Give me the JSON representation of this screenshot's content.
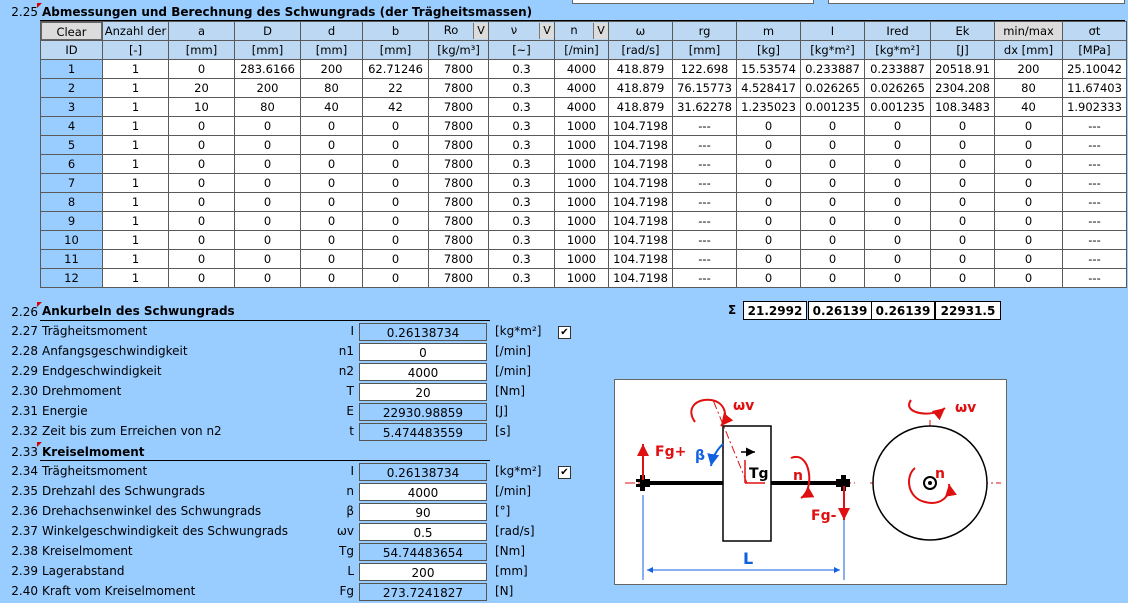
{
  "sections": {
    "s225": {
      "num": "2.25",
      "title": "Abmessungen und Berechnung des Schwungrads (der Trägheitsmassen)"
    },
    "s226": {
      "num": "2.26",
      "title": "Ankurbeln des Schwungrads"
    },
    "s233": {
      "num": "2.33",
      "title": "Kreiselmoment"
    }
  },
  "table": {
    "clear_label": "Clear",
    "v_label": "V",
    "headers": [
      "Anzahl der",
      "a",
      "D",
      "d",
      "b",
      "Ro",
      "ν",
      "n",
      "ω",
      "rg",
      "m",
      "I",
      "Ired",
      "Ek",
      "min/max",
      "σt"
    ],
    "units": [
      "ID",
      "[-]",
      "[mm]",
      "[mm]",
      "[mm]",
      "[mm]",
      "[kg/m³]",
      "[~]",
      "[/min]",
      "[rad/s]",
      "[mm]",
      "[kg]",
      "[kg*m²]",
      "[kg*m²]",
      "[J]",
      "dx [mm]",
      "[MPa]"
    ],
    "rows": [
      [
        "1",
        "1",
        "0",
        "283.6166",
        "200",
        "62.71246",
        "7800",
        "0.3",
        "4000",
        "418.879",
        "122.698",
        "15.53574",
        "0.233887",
        "0.233887",
        "20518.91",
        "200",
        "25.10042"
      ],
      [
        "2",
        "1",
        "20",
        "200",
        "80",
        "22",
        "7800",
        "0.3",
        "4000",
        "418.879",
        "76.15773",
        "4.528417",
        "0.026265",
        "0.026265",
        "2304.208",
        "80",
        "11.67403"
      ],
      [
        "3",
        "1",
        "10",
        "80",
        "40",
        "42",
        "7800",
        "0.3",
        "4000",
        "418.879",
        "31.62278",
        "1.235023",
        "0.001235",
        "0.001235",
        "108.3483",
        "40",
        "1.902333"
      ],
      [
        "4",
        "1",
        "0",
        "0",
        "0",
        "0",
        "7800",
        "0.3",
        "1000",
        "104.7198",
        "---",
        "0",
        "0",
        "0",
        "0",
        "0",
        "---"
      ],
      [
        "5",
        "1",
        "0",
        "0",
        "0",
        "0",
        "7800",
        "0.3",
        "1000",
        "104.7198",
        "---",
        "0",
        "0",
        "0",
        "0",
        "0",
        "---"
      ],
      [
        "6",
        "1",
        "0",
        "0",
        "0",
        "0",
        "7800",
        "0.3",
        "1000",
        "104.7198",
        "---",
        "0",
        "0",
        "0",
        "0",
        "0",
        "---"
      ],
      [
        "7",
        "1",
        "0",
        "0",
        "0",
        "0",
        "7800",
        "0.3",
        "1000",
        "104.7198",
        "---",
        "0",
        "0",
        "0",
        "0",
        "0",
        "---"
      ],
      [
        "8",
        "1",
        "0",
        "0",
        "0",
        "0",
        "7800",
        "0.3",
        "1000",
        "104.7198",
        "---",
        "0",
        "0",
        "0",
        "0",
        "0",
        "---"
      ],
      [
        "9",
        "1",
        "0",
        "0",
        "0",
        "0",
        "7800",
        "0.3",
        "1000",
        "104.7198",
        "---",
        "0",
        "0",
        "0",
        "0",
        "0",
        "---"
      ],
      [
        "10",
        "1",
        "0",
        "0",
        "0",
        "0",
        "7800",
        "0.3",
        "1000",
        "104.7198",
        "---",
        "0",
        "0",
        "0",
        "0",
        "0",
        "---"
      ],
      [
        "11",
        "1",
        "0",
        "0",
        "0",
        "0",
        "7800",
        "0.3",
        "1000",
        "104.7198",
        "---",
        "0",
        "0",
        "0",
        "0",
        "0",
        "---"
      ],
      [
        "12",
        "1",
        "0",
        "0",
        "0",
        "0",
        "7800",
        "0.3",
        "1000",
        "104.7198",
        "---",
        "0",
        "0",
        "0",
        "0",
        "0",
        "---"
      ]
    ],
    "sum_symbol": "Σ",
    "sums": [
      "21.2992",
      "0.26139",
      "0.26139",
      "22931.5"
    ]
  },
  "rows": [
    {
      "num": "2.27",
      "label": "Trägheitsmoment",
      "sym": "I",
      "value": "0.26138734",
      "unit": "[kg*m²]",
      "input": false,
      "check": "✔"
    },
    {
      "num": "2.28",
      "label": "Anfangsgeschwindigkeit",
      "sym": "n1",
      "value": "0",
      "unit": "[/min]",
      "input": true
    },
    {
      "num": "2.29",
      "label": "Endgeschwindigkeit",
      "sym": "n2",
      "value": "4000",
      "unit": "[/min]",
      "input": true
    },
    {
      "num": "2.30",
      "label": "Drehmoment",
      "sym": "T",
      "value": "20",
      "unit": "[Nm]",
      "input": true
    },
    {
      "num": "2.31",
      "label": "Energie",
      "sym": "E",
      "value": "22930.98859",
      "unit": "[J]",
      "input": false
    },
    {
      "num": "2.32",
      "label": "Zeit bis zum Erreichen von n2",
      "sym": "t",
      "value": "5.474483559",
      "unit": "[s]",
      "input": false
    },
    {
      "num": "2.34",
      "label": "Trägheitsmoment",
      "sym": "I",
      "value": "0.26138734",
      "unit": "[kg*m²]",
      "input": false,
      "check": "✔"
    },
    {
      "num": "2.35",
      "label": "Drehzahl des Schwungrads",
      "sym": "n",
      "value": "4000",
      "unit": "[/min]",
      "input": true
    },
    {
      "num": "2.36",
      "label": "Drehachsenwinkel des Schwungrads",
      "sym": "β",
      "value": "90",
      "unit": "[°]",
      "input": true
    },
    {
      "num": "2.37",
      "label": "Winkelgeschwindigkeit des Schwungrads",
      "sym": "ωv",
      "value": "0.5",
      "unit": "[rad/s]",
      "input": true
    },
    {
      "num": "2.38",
      "label": "Kreiselmoment",
      "sym": "Tg",
      "value": "54.74483654",
      "unit": "[Nm]",
      "input": false
    },
    {
      "num": "2.39",
      "label": "Lagerabstand",
      "sym": "L",
      "value": "200",
      "unit": "[mm]",
      "input": true
    },
    {
      "num": "2.40",
      "label": "Kraft vom Kreiselmoment",
      "sym": "Fg",
      "value": "273.7241827",
      "unit": "[N]",
      "input": false
    }
  ],
  "diagram": {
    "wv": "ωv",
    "fg_plus": "Fg+",
    "fg_minus": "Fg-",
    "beta": "β",
    "tg": "Tg",
    "n": "n",
    "L": "L",
    "wv2": "ωv",
    "n2": "n"
  },
  "colors": {
    "background": "#99ccff",
    "accent_red": "#e01010",
    "header_bg": "#bcd8f2"
  }
}
